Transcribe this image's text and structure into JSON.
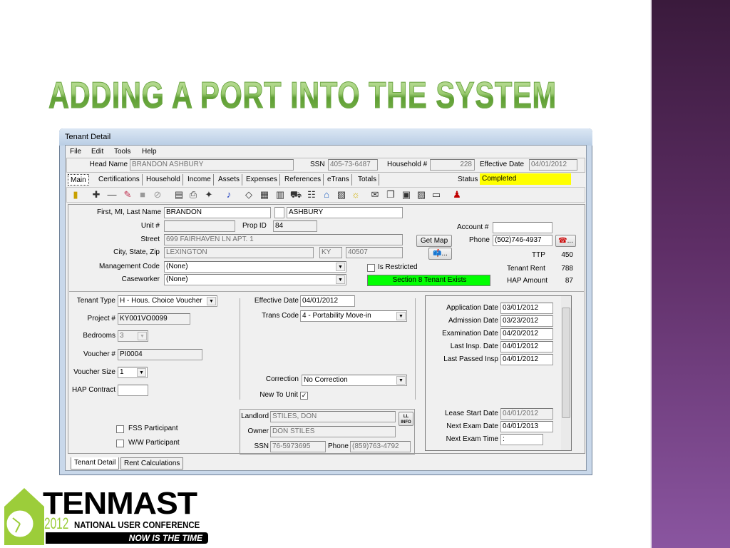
{
  "slide": {
    "title": "Adding a Port into the System",
    "colors": {
      "title_green": "#7ab84c",
      "side_bar": "#5e2e66"
    }
  },
  "logo": {
    "brand": "TENMAST",
    "year": "2012",
    "conference": "NATIONAL USER CONFERENCE",
    "tagline": "NOW IS THE TIME"
  },
  "window": {
    "title": "Tenant Detail",
    "menu": [
      "File",
      "Edit",
      "Tools",
      "Help"
    ]
  },
  "header": {
    "head_name_label": "Head Name",
    "head_name": "BRANDON ASHBURY",
    "ssn_label": "SSN",
    "ssn": "405-73-6487",
    "household_label": "Household #",
    "household": "228",
    "eff_label": "Effective Date",
    "eff": "04/01/2012",
    "status_label": "Status",
    "status": "Completed",
    "status_color": "#ffff00"
  },
  "tabs": [
    "Main",
    "Certifications",
    "Household",
    "Income",
    "Assets",
    "Expenses",
    "References",
    "eTrans",
    "Totals"
  ],
  "toolbar": [
    "exit-icon",
    "add-icon",
    "remove-icon",
    "edit-icon",
    "save-icon",
    "cancel-icon",
    "report-icon",
    "print-icon",
    "flashlight-icon",
    "music-note-icon",
    "tag-icon",
    "calculator-icon",
    "document-icon",
    "truck-icon",
    "family-icon",
    "house-icon",
    "chart-icon",
    "lightbulb-icon",
    "envelope-icon",
    "copy-icon",
    "image-icon",
    "form-icon",
    "book-icon",
    "person-check-icon"
  ],
  "main": {
    "name_label": "First, MI, Last Name",
    "first": "BRANDON",
    "mi": "",
    "last": "ASHBURY",
    "unit_label": "Unit #",
    "unit": "",
    "propid_label": "Prop ID",
    "propid": "84",
    "account_label": "Account #",
    "account": "",
    "street_label": "Street",
    "street": "699 FAIRHAVEN LN APT. 1",
    "getmap": "Get Map",
    "phone_label": "Phone",
    "phone": "(502)746-4937",
    "more": "...",
    "city_label": "City, State, Zip",
    "city": "LEXINGTON",
    "state": "KY",
    "zip": "40507",
    "ttp_label": "TTP",
    "ttp": "450",
    "mgmt_label": "Management Code",
    "mgmt": "(None)",
    "restricted_label": "Is Restricted",
    "rent_label": "Tenant Rent",
    "rent": "788",
    "caseworker_label": "Caseworker",
    "caseworker": "(None)",
    "s8": "Section 8 Tenant Exists",
    "s8_color": "#00ff00",
    "hap_label": "HAP Amount",
    "hap": "87"
  },
  "lower": {
    "tenant_type_label": "Tenant Type",
    "tenant_type": "H - Hous. Choice Voucher",
    "project_label": "Project #",
    "project": "KY001VO0099",
    "bedrooms_label": "Bedrooms",
    "bedrooms": "3",
    "voucher_label": "Voucher #",
    "voucher": "PI0004",
    "voucher_size_label": "Voucher Size",
    "voucher_size": "1",
    "hap_contract_label": "HAP Contract",
    "hap_contract": "",
    "fss_label": "FSS Participant",
    "ww_label": "W/W Participant",
    "eff_label": "Effective Date",
    "eff": "04/01/2012",
    "trans_label": "Trans Code",
    "trans": "4 - Portability Move-in",
    "correction_label": "Correction",
    "correction": "No Correction",
    "newunit_label": "New To Unit",
    "landlord_label": "Landlord",
    "landlord": "STILES, DON",
    "llinfo": "LL INFO",
    "owner_label": "Owner",
    "owner": "DON STILES",
    "ll_ssn_label": "SSN",
    "ll_ssn": "76-5973695",
    "ll_phone_label": "Phone",
    "ll_phone": "(859)763-4792",
    "dates": [
      {
        "label": "Application Date",
        "value": "03/01/2012"
      },
      {
        "label": "Admission Date",
        "value": "03/23/2012"
      },
      {
        "label": "Examination Date",
        "value": "04/20/2012"
      },
      {
        "label": "Last Insp. Date",
        "value": "04/01/2012"
      },
      {
        "label": "Last Passed Insp",
        "value": "04/01/2012"
      }
    ],
    "lease_label": "Lease Start Date",
    "lease": "04/01/2012",
    "next_exam_label": "Next Exam Date",
    "next_exam": "04/01/2013",
    "next_time_label": "Next Exam Time",
    "next_time": " :"
  },
  "bottom_tabs": [
    "Tenant Detail",
    "Rent Calculations"
  ]
}
